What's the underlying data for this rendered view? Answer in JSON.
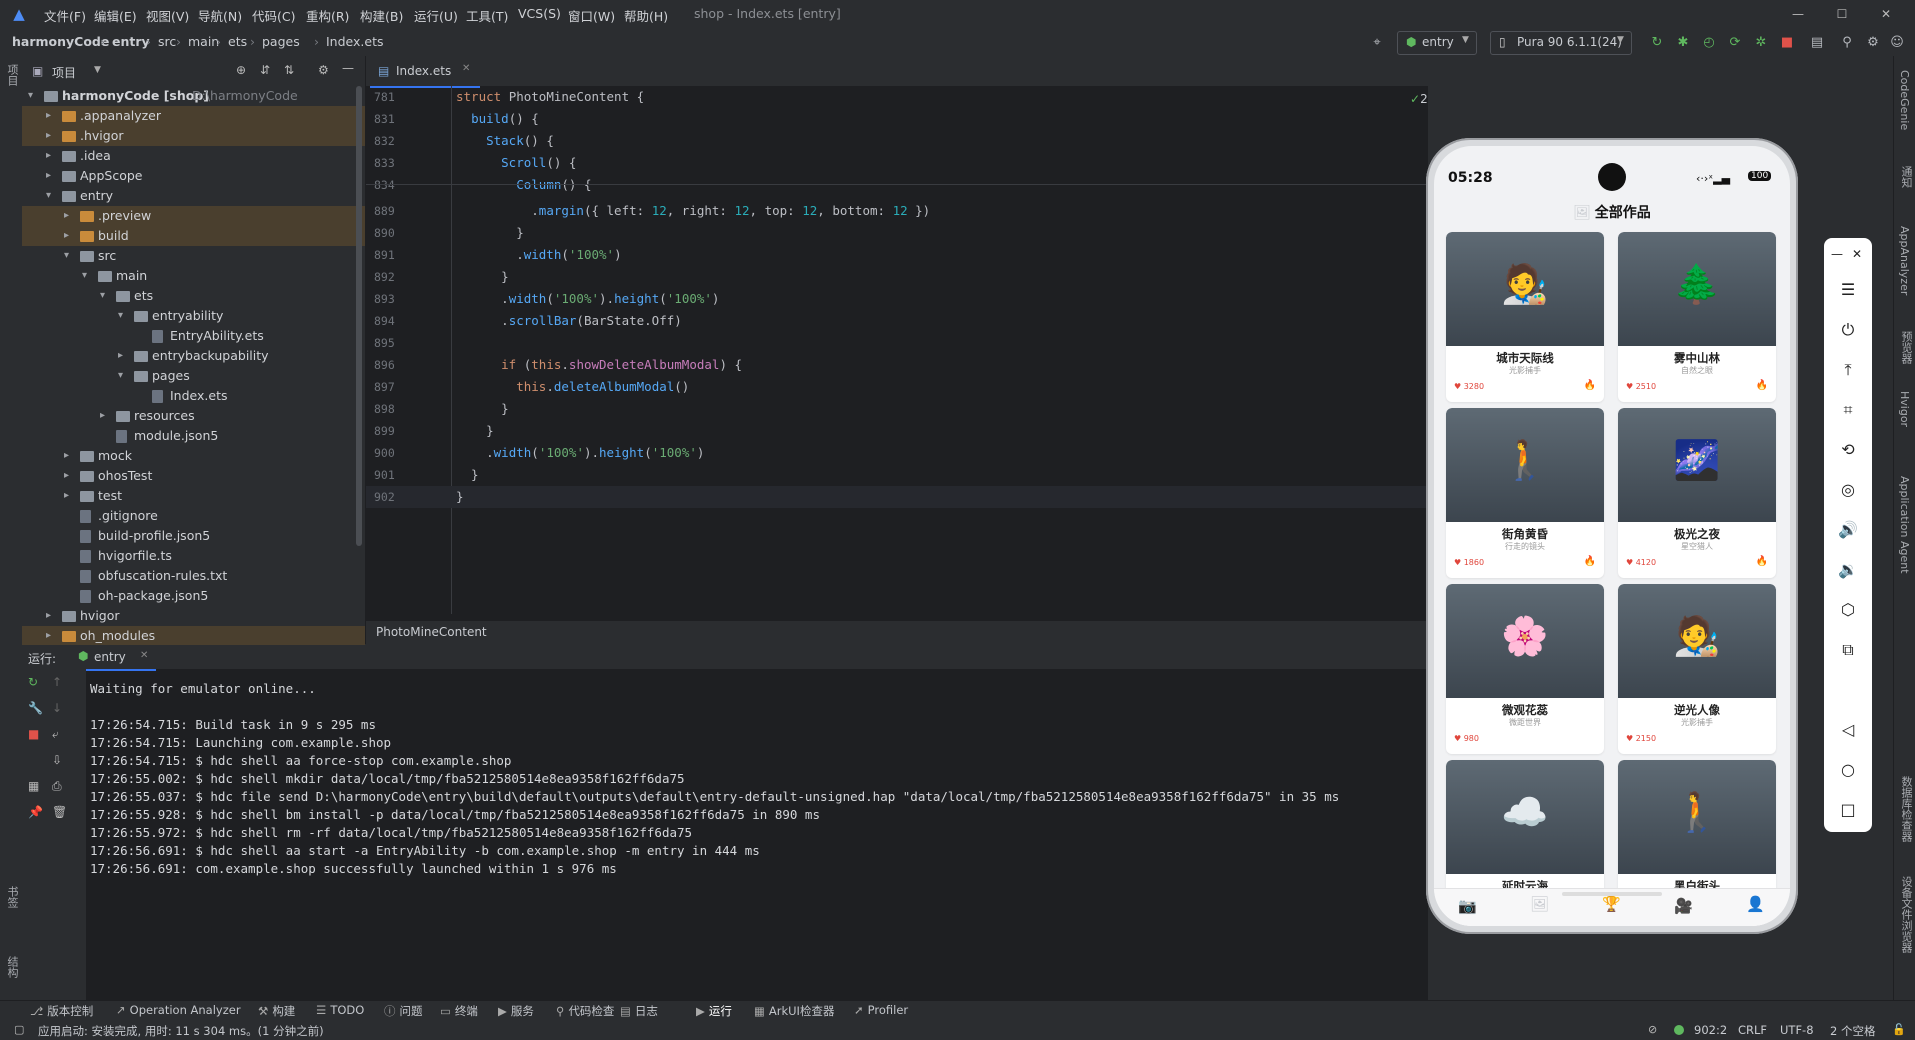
{
  "window": {
    "title": "shop - Index.ets [entry]",
    "menu": [
      "文件(F)",
      "编辑(E)",
      "视图(V)",
      "导航(N)",
      "代码(C)",
      "重构(R)",
      "构建(B)",
      "运行(U)",
      "工具(T)",
      "VCS(S)",
      "窗口(W)",
      "帮助(H)"
    ]
  },
  "breadcrumb": [
    "harmonyCode",
    "entry",
    "src",
    "main",
    "ets",
    "pages",
    "Index.ets"
  ],
  "toolbar": {
    "config": "entry",
    "device": "Pura 90 6.1.1(24)"
  },
  "project": {
    "label": "项目",
    "tree": [
      {
        "name": "harmonyCode [shop]",
        "extra": "D:\\harmonyCode",
        "depth": 0,
        "open": true,
        "type": "folder",
        "hl": false
      },
      {
        "name": ".appanalyzer",
        "depth": 1,
        "open": false,
        "type": "folder-o",
        "hl": true
      },
      {
        "name": ".hvigor",
        "depth": 1,
        "open": false,
        "type": "folder-o",
        "hl": true
      },
      {
        "name": ".idea",
        "depth": 1,
        "open": false,
        "type": "folder",
        "hl": false
      },
      {
        "name": "AppScope",
        "depth": 1,
        "open": false,
        "type": "folder",
        "hl": false
      },
      {
        "name": "entry",
        "depth": 1,
        "open": true,
        "type": "folder",
        "hl": false
      },
      {
        "name": ".preview",
        "depth": 2,
        "open": false,
        "type": "folder-o",
        "hl": true
      },
      {
        "name": "build",
        "depth": 2,
        "open": false,
        "type": "folder-o",
        "hl": true
      },
      {
        "name": "src",
        "depth": 2,
        "open": true,
        "type": "folder",
        "hl": false
      },
      {
        "name": "main",
        "depth": 3,
        "open": true,
        "type": "folder",
        "hl": false
      },
      {
        "name": "ets",
        "depth": 4,
        "open": true,
        "type": "folder",
        "hl": false
      },
      {
        "name": "entryability",
        "depth": 5,
        "open": true,
        "type": "folder",
        "hl": false
      },
      {
        "name": "EntryAbility.ets",
        "depth": 6,
        "open": null,
        "type": "file",
        "hl": false
      },
      {
        "name": "entrybackupability",
        "depth": 5,
        "open": false,
        "type": "folder",
        "hl": false
      },
      {
        "name": "pages",
        "depth": 5,
        "open": true,
        "type": "folder",
        "hl": false
      },
      {
        "name": "Index.ets",
        "depth": 6,
        "open": null,
        "type": "file",
        "hl": false
      },
      {
        "name": "resources",
        "depth": 4,
        "open": false,
        "type": "folder",
        "hl": false
      },
      {
        "name": "module.json5",
        "depth": 4,
        "open": null,
        "type": "file",
        "hl": false
      },
      {
        "name": "mock",
        "depth": 2,
        "open": false,
        "type": "folder",
        "hl": false
      },
      {
        "name": "ohosTest",
        "depth": 2,
        "open": false,
        "type": "folder",
        "hl": false
      },
      {
        "name": "test",
        "depth": 2,
        "open": false,
        "type": "folder",
        "hl": false
      },
      {
        "name": ".gitignore",
        "depth": 2,
        "open": null,
        "type": "file",
        "hl": false
      },
      {
        "name": "build-profile.json5",
        "depth": 2,
        "open": null,
        "type": "file",
        "hl": false
      },
      {
        "name": "hvigorfile.ts",
        "depth": 2,
        "open": null,
        "type": "file",
        "hl": false
      },
      {
        "name": "obfuscation-rules.txt",
        "depth": 2,
        "open": null,
        "type": "file",
        "hl": false
      },
      {
        "name": "oh-package.json5",
        "depth": 2,
        "open": null,
        "type": "file",
        "hl": false
      },
      {
        "name": "hvigor",
        "depth": 1,
        "open": false,
        "type": "folder",
        "hl": false
      },
      {
        "name": "oh_modules",
        "depth": 1,
        "open": false,
        "type": "folder-o",
        "hl": true
      }
    ]
  },
  "editor": {
    "tab": "Index.ets",
    "inspection": "2",
    "breadcrumb_bottom": "PhotoMineContent",
    "lines": [
      {
        "n": "781",
        "html": "<span class=\"kw\">struct</span> <span class=\"cl\">PhotoMineContent</span> <span class=\"cl\">{</span>"
      },
      {
        "n": "831",
        "html": "  <span class=\"fn\">build</span>() {"
      },
      {
        "n": "832",
        "html": "    <span class=\"fn\">Stack</span>() {"
      },
      {
        "n": "833",
        "html": "      <span class=\"fn\">Scroll</span>() {"
      },
      {
        "n": "834",
        "html": "        <span class=\"fn\">Column</span>() {"
      },
      {
        "n": "889",
        "html": "          .<span class=\"fn\">margin</span>({ left: <span class=\"num\">12</span>, right: <span class=\"num\">12</span>, top: <span class=\"num\">12</span>, bottom: <span class=\"num\">12</span> })"
      },
      {
        "n": "890",
        "html": "        }"
      },
      {
        "n": "891",
        "html": "        .<span class=\"fn\">width</span>(<span class=\"str\">'100%'</span>)"
      },
      {
        "n": "892",
        "html": "      }"
      },
      {
        "n": "893",
        "html": "      .<span class=\"fn\">width</span>(<span class=\"str\">'100%'</span>).<span class=\"fn\">height</span>(<span class=\"str\">'100%'</span>)"
      },
      {
        "n": "894",
        "html": "      .<span class=\"fn\">scrollBar</span>(BarState.Off)"
      },
      {
        "n": "895",
        "html": ""
      },
      {
        "n": "896",
        "html": "      <span class=\"kw\">if</span> (<span class=\"kw\">this</span>.<span class=\"pr\">showDeleteAlbumModal</span>) {"
      },
      {
        "n": "897",
        "html": "        <span class=\"kw\">this</span>.<span class=\"fn\">deleteAlbumModal</span>()"
      },
      {
        "n": "898",
        "html": "      }"
      },
      {
        "n": "899",
        "html": "    }"
      },
      {
        "n": "900",
        "html": "    .<span class=\"fn\">width</span>(<span class=\"str\">'100%'</span>).<span class=\"fn\">height</span>(<span class=\"str\">'100%'</span>)"
      },
      {
        "n": "901",
        "html": "  }"
      },
      {
        "n": "902",
        "html": "}"
      }
    ]
  },
  "run": {
    "label": "运行:",
    "tab": "entry",
    "log": [
      "Waiting for emulator online...",
      "",
      "17:26:54.715: Build task in 9 s 295 ms",
      "17:26:54.715: Launching com.example.shop",
      "17:26:54.715: $ hdc shell aa force-stop com.example.shop",
      "17:26:55.002: $ hdc shell mkdir data/local/tmp/fba5212580514e8ea9358f162ff6da75",
      "17:26:55.037: $ hdc file send D:\\harmonyCode\\entry\\build\\default\\outputs\\default\\entry-default-unsigned.hap \"data/local/tmp/fba5212580514e8ea9358f162ff6da75\" in 35 ms",
      "17:26:55.928: $ hdc shell bm install -p data/local/tmp/fba5212580514e8ea9358f162ff6da75 in 890 ms",
      "17:26:55.972: $ hdc shell rm -rf data/local/tmp/fba5212580514e8ea9358f162ff6da75",
      "17:26:56.691: $ hdc shell aa start -a EntryAbility -b com.example.shop -m entry in 444 ms",
      "17:26:56.691: com.example.shop successfully launched within 1 s 976 ms"
    ]
  },
  "bottom_tools": [
    "版本控制",
    "Operation Analyzer",
    "构建",
    "TODO",
    "问题",
    "终端",
    "服务",
    "代码检查",
    "日志",
    "运行",
    "ArkUI检查器",
    "Profiler"
  ],
  "status": {
    "left": "应用启动: 安装完成, 用时: 11 s 304 ms。(1 分钟之前)",
    "pos": "902:2",
    "eol": "CRLF",
    "enc": "UTF-8",
    "indent": "2 个空格"
  },
  "right_strip": [
    "CodeGenie",
    "通知",
    "AppAnalyzer",
    "预览器",
    "Hvigor",
    "Application Agent",
    "数据库检查器",
    "设备文件浏览器"
  ],
  "left_strip": [
    "项目",
    "书签",
    "结构"
  ],
  "phone": {
    "time": "05:28",
    "battery": "100",
    "header": "全部作品",
    "works": [
      {
        "title": "城市天际线",
        "sub": "光影捕手",
        "likes": "3280",
        "emoji": "🧑‍🎨",
        "hot": true
      },
      {
        "title": "雾中山林",
        "sub": "自然之眼",
        "likes": "2510",
        "emoji": "🌲",
        "hot": true
      },
      {
        "title": "街角黄昏",
        "sub": "行走的镜头",
        "likes": "1860",
        "emoji": "🚶",
        "hot": true
      },
      {
        "title": "极光之夜",
        "sub": "星空猎人",
        "likes": "4120",
        "emoji": "🌌",
        "hot": true
      },
      {
        "title": "微观花蕊",
        "sub": "微距世界",
        "likes": "980",
        "emoji": "🌸",
        "hot": false
      },
      {
        "title": "逆光人像",
        "sub": "光影捕手",
        "likes": "2150",
        "emoji": "🧑‍🎨",
        "hot": false
      },
      {
        "title": "延时云海",
        "sub": "",
        "likes": "",
        "emoji": "☁️",
        "hot": false
      },
      {
        "title": "黑白街头",
        "sub": "",
        "likes": "",
        "emoji": "🚶",
        "hot": false
      }
    ]
  }
}
